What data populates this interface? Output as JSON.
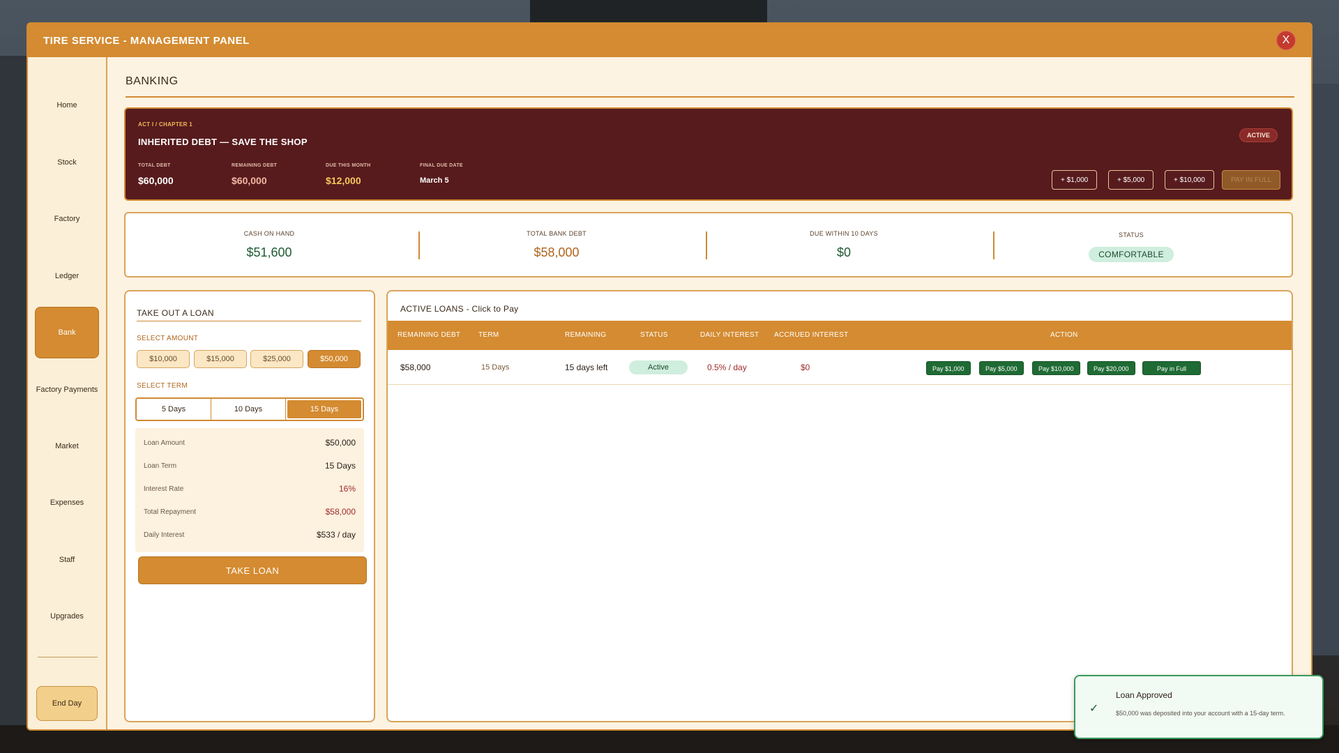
{
  "window": {
    "title": "TIRE SERVICE - MANAGEMENT PANEL",
    "close_label": "X"
  },
  "sidebar": {
    "items": [
      {
        "label": "Home"
      },
      {
        "label": "Stock"
      },
      {
        "label": "Factory"
      },
      {
        "label": "Ledger"
      },
      {
        "label": "Bank"
      },
      {
        "label": "Factory Payments"
      },
      {
        "label": "Market"
      },
      {
        "label": "Expenses"
      },
      {
        "label": "Staff"
      },
      {
        "label": "Upgrades"
      }
    ],
    "active": "Bank",
    "end_day_label": "End Day"
  },
  "page": {
    "title": "BANKING"
  },
  "story": {
    "chapter": "ACT I / CHAPTER 1",
    "title": "INHERITED DEBT — SAVE THE SHOP",
    "badge": "ACTIVE",
    "stats": [
      {
        "label": "TOTAL DEBT",
        "value": "$60,000",
        "color": "#ffffff"
      },
      {
        "label": "REMAINING DEBT",
        "value": "$60,000",
        "color": "#f2b8a4"
      },
      {
        "label": "DUE THIS MONTH",
        "value": "$12,000",
        "color": "#f7c85a"
      },
      {
        "label": "FINAL DUE DATE",
        "value": "March 5",
        "color": "#ffffff"
      }
    ],
    "buttons": [
      "+ $1,000",
      "+ $5,000",
      "+ $10,000",
      "PAY IN FULL"
    ]
  },
  "summary": {
    "cash_label": "CASH ON HAND",
    "cash_value": "$51,600",
    "debt_label": "TOTAL BANK DEBT",
    "debt_value": "$58,000",
    "due_label": "DUE WITHIN 10 DAYS",
    "due_value": "$0",
    "status_label": "STATUS",
    "status_value": "COMFORTABLE"
  },
  "loan_form": {
    "title": "TAKE OUT A LOAN",
    "amount_label": "SELECT AMOUNT",
    "amounts": [
      "$10,000",
      "$15,000",
      "$25,000",
      "$50,000"
    ],
    "selected_amount": "$50,000",
    "term_label": "SELECT TERM",
    "terms": [
      "5 Days",
      "10 Days",
      "15 Days"
    ],
    "selected_term": "15 Days",
    "details": [
      {
        "label": "Loan Amount",
        "value": "$50,000"
      },
      {
        "label": "Loan Term",
        "value": "15 Days"
      },
      {
        "label": "Interest Rate",
        "value": "16%"
      },
      {
        "label": "Total Repayment",
        "value": "$58,000"
      },
      {
        "label": "Daily Interest",
        "value": "$533 / day"
      }
    ],
    "submit_label": "TAKE LOAN"
  },
  "active_loans": {
    "title": "ACTIVE LOANS - Click to Pay",
    "columns": [
      "REMAINING DEBT",
      "TERM",
      "REMAINING",
      "STATUS",
      "DAILY INTEREST",
      "ACCRUED INTEREST",
      "ACTION"
    ],
    "rows": [
      {
        "remaining_debt": "$58,000",
        "term": "15 Days",
        "remaining": "15 days left",
        "status": "Active",
        "daily_interest": "0.5% / day",
        "accrued_interest": "$0",
        "actions": [
          "Pay $1,000",
          "Pay $5,000",
          "Pay $10,000",
          "Pay $20,000",
          "Pay in Full"
        ]
      }
    ]
  },
  "toast": {
    "icon": "check-icon",
    "title": "Loan Approved",
    "message": "$50,000 was deposited into your account with a 15-day term."
  },
  "colors": {
    "accent": "#d48b31",
    "story_bg": "#571b1d",
    "positive": "#1f6b34",
    "negative": "#a02c2c"
  }
}
